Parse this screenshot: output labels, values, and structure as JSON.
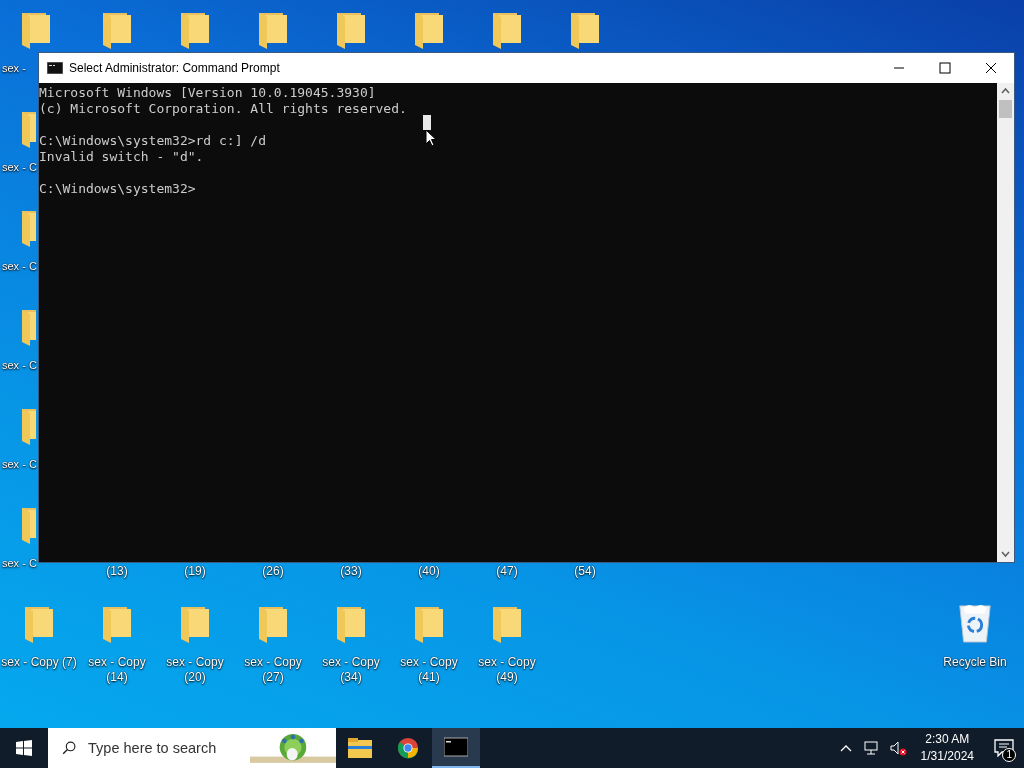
{
  "desktop": {
    "top_row": [
      {
        "kind": "folder",
        "label": "sex -"
      },
      {
        "kind": "folder"
      },
      {
        "kind": "folder"
      },
      {
        "kind": "folder"
      },
      {
        "kind": "folder"
      },
      {
        "kind": "folder"
      },
      {
        "kind": "folder"
      },
      {
        "kind": "folder"
      }
    ],
    "left_column": [
      {
        "kind": "folder",
        "label": "sex - C"
      },
      {
        "kind": "folder",
        "label": "sex - C"
      },
      {
        "kind": "folder",
        "label": "sex - C"
      },
      {
        "kind": "folder",
        "label": "sex - C"
      },
      {
        "kind": "folder",
        "label": "sex - C"
      }
    ],
    "partial_row": [
      {
        "kind": "label",
        "label": "(13)"
      },
      {
        "kind": "label",
        "label": "(19)"
      },
      {
        "kind": "label",
        "label": "(26)"
      },
      {
        "kind": "label",
        "label": "(33)"
      },
      {
        "kind": "label",
        "label": "(40)"
      },
      {
        "kind": "label",
        "label": "(47)"
      },
      {
        "kind": "label",
        "label": "(54)"
      }
    ],
    "bottom_row": [
      {
        "kind": "folder",
        "label": "sex - Copy (7)"
      },
      {
        "kind": "folder",
        "label": "sex - Copy (14)"
      },
      {
        "kind": "folder",
        "label": "sex - Copy (20)"
      },
      {
        "kind": "folder",
        "label": "sex - Copy (27)"
      },
      {
        "kind": "folder",
        "label": "sex - Copy (34)"
      },
      {
        "kind": "folder",
        "label": "sex - Copy (41)"
      },
      {
        "kind": "folder",
        "label": "sex - Copy (49)"
      }
    ],
    "recycle_bin": {
      "label": "Recycle Bin"
    }
  },
  "window": {
    "title": "Select Administrator: Command Prompt",
    "blocks": [
      [
        "Microsoft Windows [Version 10.0.19045.3930]",
        "(c) Microsoft Corporation. All rights reserved."
      ],
      [
        "C:\\Windows\\system32>rd c:] /d",
        "Invalid switch - \"d\"."
      ],
      [
        "C:\\Windows\\system32>"
      ]
    ]
  },
  "taskbar": {
    "search": {
      "placeholder": "Type here to search"
    },
    "apps": [
      {
        "kind": "explorer",
        "active": false
      },
      {
        "kind": "chrome",
        "active": false
      },
      {
        "kind": "cmd",
        "active": true
      }
    ],
    "clock": {
      "time": "2:30 AM",
      "date": "1/31/2024"
    },
    "notifications": "1"
  }
}
